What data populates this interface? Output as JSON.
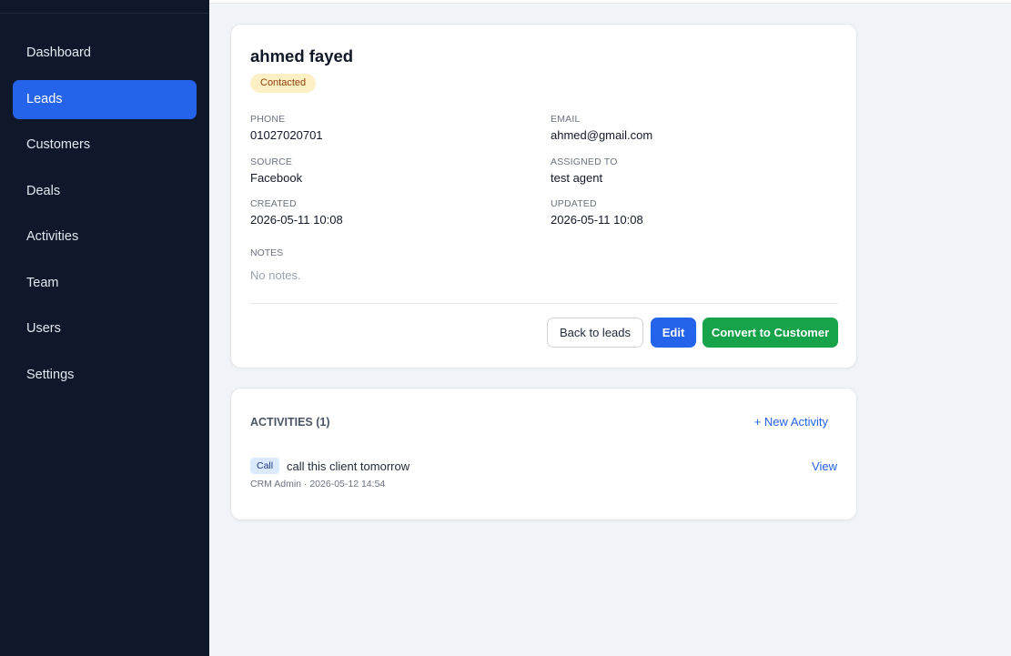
{
  "sidebar": {
    "items": [
      {
        "label": "Dashboard"
      },
      {
        "label": "Leads"
      },
      {
        "label": "Customers"
      },
      {
        "label": "Deals"
      },
      {
        "label": "Activities"
      },
      {
        "label": "Team"
      },
      {
        "label": "Users"
      },
      {
        "label": "Settings"
      }
    ],
    "active": "Leads"
  },
  "lead": {
    "name": "ahmed fayed",
    "status": "Contacted",
    "fields": {
      "phone_label": "PHONE",
      "phone": "01027020701",
      "email_label": "EMAIL",
      "email": "ahmed@gmail.com",
      "source_label": "SOURCE",
      "source": "Facebook",
      "assigned_label": "ASSIGNED TO",
      "assigned": "test agent",
      "created_label": "CREATED",
      "created": "2026-05-11 10:08",
      "updated_label": "UPDATED",
      "updated": "2026-05-11 10:08"
    },
    "notes_label": "NOTES",
    "notes": "No notes."
  },
  "actions": {
    "back_label": "Back to leads",
    "edit_label": "Edit",
    "convert_label": "Convert to Customer"
  },
  "activities": {
    "title": "ACTIVITIES (1)",
    "new_label": "+ New Activity",
    "items": [
      {
        "type": "Call",
        "text": "call this client tomorrow",
        "meta": "CRM Admin · 2026-05-12 14:54",
        "view_label": "View"
      }
    ]
  },
  "colors": {
    "sidebar_bg": "#0f172a",
    "accent": "#2563eb",
    "success": "#16a34a",
    "status_badge_bg": "#fdf0c4",
    "page_bg": "#f0f3f8"
  }
}
